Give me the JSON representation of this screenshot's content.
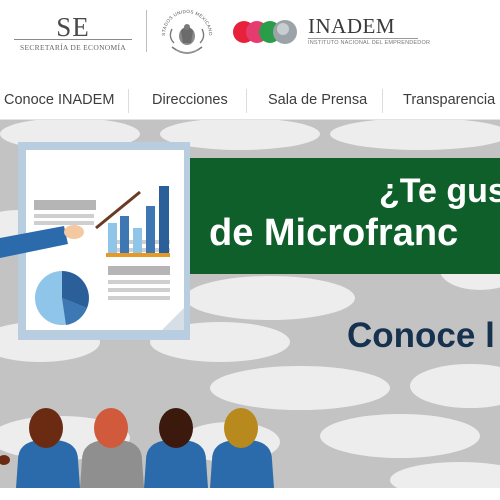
{
  "header": {
    "se_logo": {
      "abbr": "SE",
      "name": "SECRETARÍA DE ECONOMÍA"
    },
    "seal": {
      "caption": "ESTADOS UNIDOS MEXICANOS"
    },
    "inadem_logo": {
      "name": "INADEM",
      "subtitle": "INSTITUTO NACIONAL DEL EMPRENDEDOR"
    }
  },
  "nav": {
    "items": [
      "Conoce INADEM",
      "Direcciones",
      "Sala de Prensa",
      "Transparencia"
    ]
  },
  "banner": {
    "headline_line1": "¿Te gus",
    "headline_line2": "de Microfranc",
    "subline": "Conoce l"
  },
  "colors": {
    "banner_green": "#0f5f2a",
    "subline_navy": "#17324f",
    "banner_bg": "#c3c3c3",
    "inadem_dots": [
      "#e8213a",
      "#e63b6f",
      "#2a9d4a",
      "#9aa3a8"
    ]
  },
  "icons": [
    "presenter-illustration",
    "bar-chart-icon",
    "pie-chart-icon",
    "pointer-stick-icon",
    "audience-figures"
  ]
}
